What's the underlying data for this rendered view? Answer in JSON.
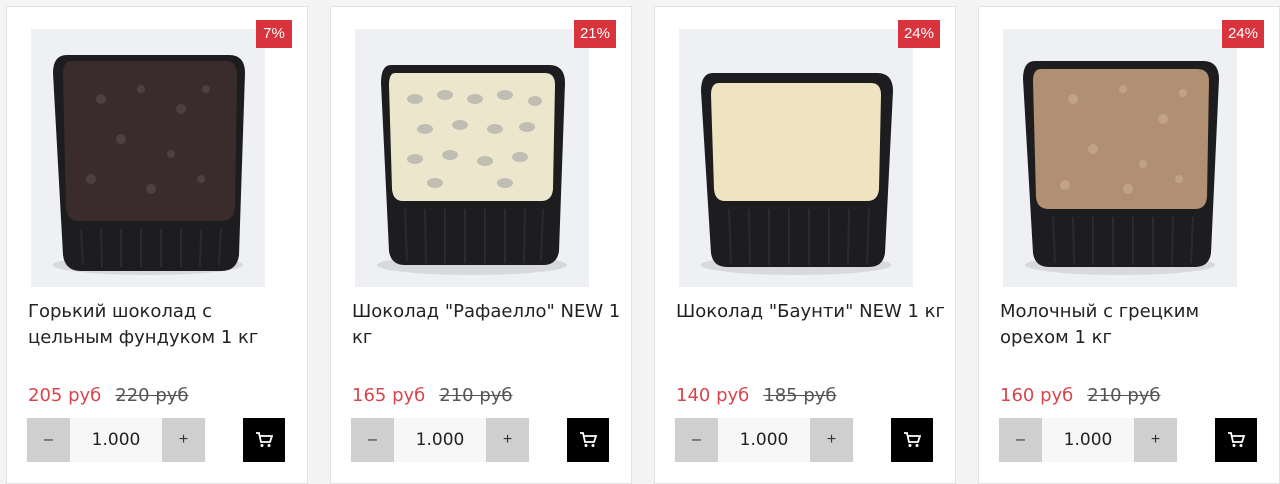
{
  "products": [
    {
      "discount": "7%",
      "title": "Горький шоколад с цельным фундуком 1 кг",
      "price": "205 руб",
      "old_price": "220 руб",
      "qty": "1.000",
      "minus": "–",
      "plus": "+",
      "fill_color": "#3a2c2c",
      "cart_icon": "shopping-cart"
    },
    {
      "discount": "21%",
      "title": "Шоколад \"Рафаелло\" NEW 1 кг",
      "price": "165 руб",
      "old_price": "210 руб",
      "qty": "1.000",
      "minus": "–",
      "plus": "+",
      "fill_color": "#ece7cc",
      "cart_icon": "shopping-cart"
    },
    {
      "discount": "24%",
      "title": "Шоколад \"Баунти\" NEW 1 кг",
      "price": "140 руб",
      "old_price": "185 руб",
      "qty": "1.000",
      "minus": "–",
      "plus": "+",
      "fill_color": "#eee4c1",
      "cart_icon": "shopping-cart"
    },
    {
      "discount": "24%",
      "title": "Молочный с грецким орехом 1 кг",
      "price": "160 руб",
      "old_price": "210 руб",
      "qty": "1.000",
      "minus": "–",
      "plus": "+",
      "fill_color": "#b08f72",
      "cart_icon": "shopping-cart"
    }
  ],
  "colors": {
    "badge": "#d9343d",
    "price": "#d9454d",
    "cart_button": "#000000"
  }
}
